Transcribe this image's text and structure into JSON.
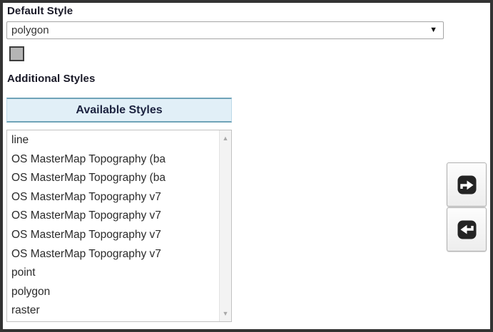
{
  "frame": {
    "background": "#ffffff",
    "border_color": "#333333"
  },
  "default_style": {
    "label": "Default Style",
    "selected_option": "polygon",
    "dropdown_arrow": "▼"
  },
  "style_preview": {
    "swatch_fill": "#b5b5b5",
    "swatch_border": "#3d3d3d"
  },
  "additional_styles": {
    "label": "Additional Styles",
    "available_list": {
      "header": "Available Styles",
      "header_background": "#e1eff7",
      "header_border_color": "#6fa3b8",
      "items": [
        "line",
        "OS MasterMap Topography (ba",
        "OS MasterMap Topography (ba",
        "OS MasterMap Topography v7",
        "OS MasterMap Topography v7",
        "OS MasterMap Topography v7",
        "OS MasterMap Topography v7",
        "point",
        "polygon",
        "raster"
      ],
      "scrollbar": {
        "up_arrow": "▲",
        "down_arrow": "▼"
      }
    }
  },
  "transfer_buttons": {
    "move_right": "move-selected-right",
    "move_left": "move-selected-left",
    "icon_background": "#242424",
    "icon_arrow_color": "#ffffff"
  }
}
